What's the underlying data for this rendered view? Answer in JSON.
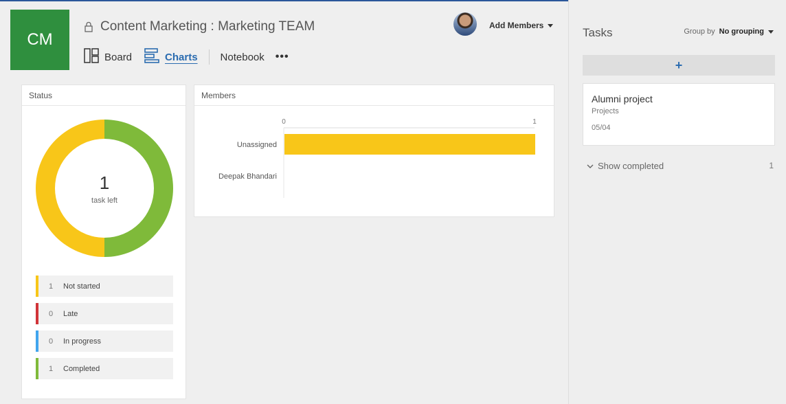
{
  "header": {
    "tile_initials": "CM",
    "title": "Content Marketing : Marketing TEAM",
    "nav": {
      "board": "Board",
      "charts": "Charts",
      "notebook": "Notebook",
      "more": "•••"
    },
    "add_members": "Add Members"
  },
  "status": {
    "heading": "Status",
    "center_count": "1",
    "center_label": "task left",
    "legend": [
      {
        "count": "1",
        "label": "Not started",
        "color": "#f8c619"
      },
      {
        "count": "0",
        "label": "Late",
        "color": "#d13438"
      },
      {
        "count": "0",
        "label": "In progress",
        "color": "#41a5ee"
      },
      {
        "count": "1",
        "label": "Completed",
        "color": "#7fba3a"
      }
    ]
  },
  "members": {
    "heading": "Members"
  },
  "chart_data": [
    {
      "type": "pie",
      "title": "Status",
      "categories": [
        "Not started",
        "Late",
        "In progress",
        "Completed"
      ],
      "values": [
        1,
        0,
        0,
        1
      ],
      "colors": [
        "#f8c619",
        "#d13438",
        "#41a5ee",
        "#7fba3a"
      ]
    },
    {
      "type": "bar",
      "orientation": "horizontal",
      "title": "Members",
      "categories": [
        "Unassigned",
        "Deepak Bhandari"
      ],
      "values": [
        1,
        0
      ],
      "xlim": [
        0,
        1
      ],
      "xticks": [
        "0",
        "1"
      ],
      "color": "#f8c619"
    }
  ],
  "tasks": {
    "title": "Tasks",
    "group_by_label": "Group by",
    "group_by_value": "No grouping",
    "add": "+",
    "items": [
      {
        "name": "Alumni project",
        "bucket": "Projects",
        "date": "05/04"
      }
    ],
    "show_completed": "Show completed",
    "completed_count": "1"
  }
}
